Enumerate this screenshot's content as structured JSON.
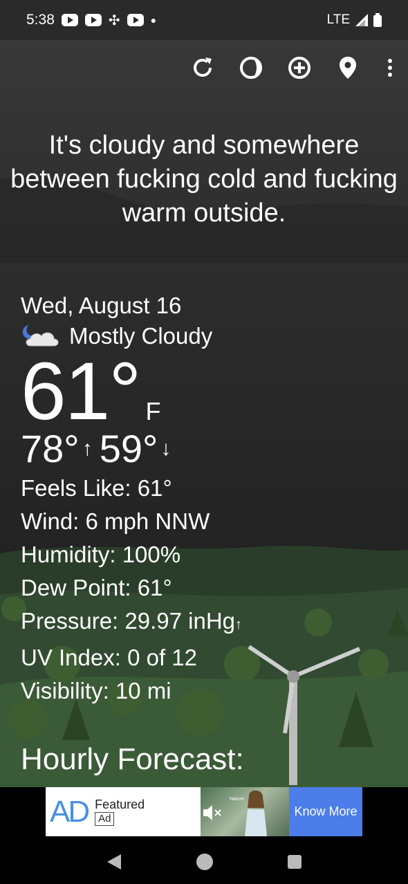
{
  "status_bar": {
    "time": "5:38",
    "network": "LTE"
  },
  "toolbar": {
    "icons": [
      "refresh-icon",
      "moon-phase-icon",
      "add-location-icon",
      "location-pin-icon",
      "more-vert-icon"
    ]
  },
  "headline": "It's cloudy and somewhere between fucking cold and fucking warm outside.",
  "weather": {
    "date": "Wed, August 16",
    "condition": "Mostly Cloudy",
    "condition_icon": "partly-cloudy-night-icon",
    "temperature": "61°",
    "unit": "F",
    "high": "78°",
    "low": "59°",
    "details": {
      "feels_like": "Feels Like:  61°",
      "wind": "Wind:  6 mph NNW",
      "humidity": "Humidity:  100%",
      "dew_point": "Dew Point:  61°",
      "pressure": "Pressure:  29.97 inHg",
      "uv_index": "UV Index:  0 of 12",
      "visibility": "Visibility:  10 mi"
    }
  },
  "hourly_title": "Hourly Forecast:",
  "ad": {
    "logo": "AD",
    "label": "Featured",
    "badge": "Ad",
    "button": "Know More",
    "image_caption": "Nature"
  },
  "nav": {
    "buttons": [
      "back",
      "home",
      "recents"
    ]
  },
  "colors": {
    "accent_ad_button": "#4c7de8",
    "ad_logo": "#4a90e2"
  }
}
